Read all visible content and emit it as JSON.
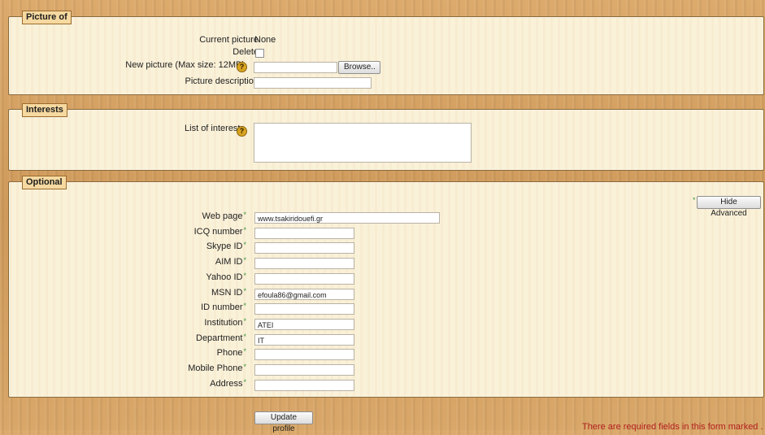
{
  "picture_section": {
    "legend": "Picture of",
    "current_picture_label": "Current picture",
    "current_picture_value": "None",
    "delete_label": "Delete",
    "new_picture_label": "New picture (Max size: 12MB)",
    "browse_label": "Browse..",
    "picture_description_label": "Picture description",
    "new_picture_value": "",
    "picture_description_value": ""
  },
  "interests_section": {
    "legend": "Interests",
    "list_label": "List of interests",
    "list_value": ""
  },
  "optional_section": {
    "legend": "Optional",
    "hide_advanced_label": "Hide Advanced",
    "required_mark": "*",
    "fields": [
      {
        "label": "Web page",
        "value": "www.tsakiridouefi.gr"
      },
      {
        "label": "ICQ number",
        "value": ""
      },
      {
        "label": "Skype ID",
        "value": ""
      },
      {
        "label": "AIM ID",
        "value": ""
      },
      {
        "label": "Yahoo ID",
        "value": ""
      },
      {
        "label": "MSN ID",
        "value": "efoula86@gmail.com"
      },
      {
        "label": "ID number",
        "value": ""
      },
      {
        "label": "Institution",
        "value": "ATEI"
      },
      {
        "label": "Department",
        "value": "IT"
      },
      {
        "label": "Phone",
        "value": ""
      },
      {
        "label": "Mobile Phone",
        "value": ""
      },
      {
        "label": "Address",
        "value": ""
      }
    ]
  },
  "footer": {
    "update_label": "Update profile",
    "required_note": "There are required fields in this form marked ."
  },
  "help_glyph": "?",
  "icons": {
    "help": "help-icon"
  }
}
